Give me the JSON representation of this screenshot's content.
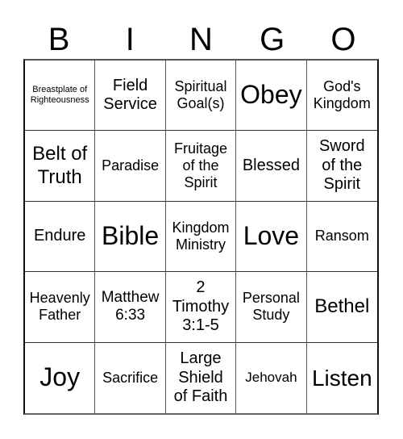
{
  "header": {
    "letters": [
      "B",
      "I",
      "N",
      "G",
      "O"
    ]
  },
  "board": {
    "rows": [
      [
        "Breastplate of Righteousness",
        "Field Service",
        "Spiritual Goal(s)",
        "Obey",
        "God's Kingdom"
      ],
      [
        "Belt of Truth",
        "Paradise",
        "Fruitage of the Spirit",
        "Blessed",
        "Sword of the Spirit"
      ],
      [
        "Endure",
        "Bible",
        "Kingdom Ministry",
        "Love",
        "Ransom"
      ],
      [
        "Heavenly Father",
        "Matthew 6:33",
        "2 Timothy 3:1-5",
        "Personal Study",
        "Bethel"
      ],
      [
        "Joy",
        "Sacrifice",
        "Large Shield of Faith",
        "Jehovah",
        "Listen"
      ]
    ]
  },
  "colors": {
    "border": "#333333",
    "text": "#000000",
    "background": "#ffffff"
  }
}
